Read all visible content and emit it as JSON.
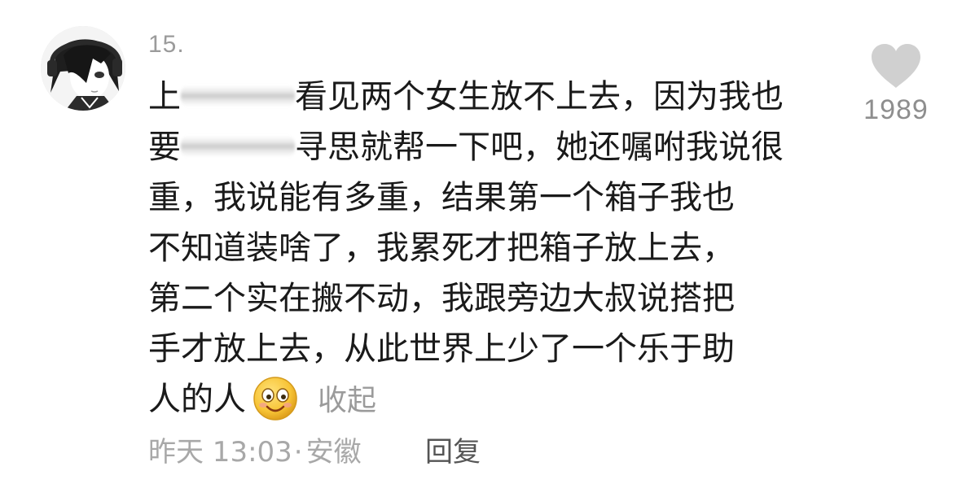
{
  "comment": {
    "index": "15.",
    "lines": [
      {
        "before": "上",
        "after": "看见两个女生放不上去，因为我也"
      },
      {
        "before": "要",
        "after": "寻思就帮一下吧，她还嘱咐我说很"
      },
      {
        "text": "重，我说能有多重，结果第一个箱子我也"
      },
      {
        "text": "不知道装啥了，我累死才把箱子放上去，"
      },
      {
        "text": "第二个实在搬不动，我跟旁边大叔说搭把"
      },
      {
        "text": "手才放上去，从此世界上少了一个乐于助"
      },
      {
        "text": "人的人"
      }
    ],
    "emoji": "smiling-face-emoji",
    "collapse_label": "收起",
    "time": "昨天 13:03",
    "separator": "·",
    "location": "安徽",
    "reply_label": "回复",
    "likes": "1989"
  },
  "colors": {
    "text": "#1a1a1a",
    "muted": "#9b9b9b",
    "heart": "#d0d0d0",
    "emoji_face": "#f7c436"
  },
  "icons": {
    "like": "heart-icon",
    "avatar": "anime-avatar"
  }
}
